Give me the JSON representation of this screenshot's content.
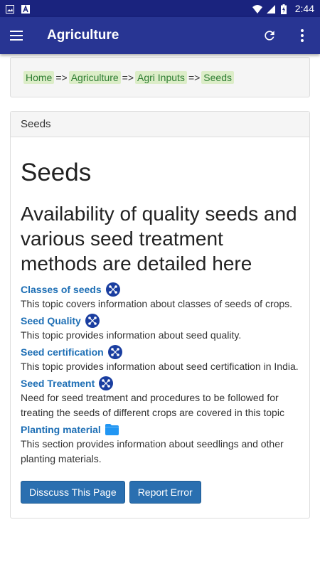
{
  "status_bar": {
    "time": "2:44",
    "icons": [
      "image-icon",
      "notification-a-icon",
      "wifi-icon",
      "signal-icon",
      "battery-charging-icon"
    ]
  },
  "app_bar": {
    "title": "Agriculture",
    "menu_icon": "hamburger-menu-icon",
    "refresh_icon": "refresh-icon",
    "more_icon": "more-vertical-icon",
    "bg_color": "#283593"
  },
  "breadcrumb": {
    "items": [
      "Home",
      "Agriculture",
      "Agri Inputs",
      "Seeds"
    ],
    "separator": "=>"
  },
  "panel": {
    "header": "Seeds",
    "heading": "Seeds",
    "subheading": "Availability of quality seeds and various seed treatment methods are detailed here"
  },
  "topics": [
    {
      "title": "Classes of seeds",
      "icon": "topic-hub-icon",
      "desc": "This topic covers information about classes of seeds of crops."
    },
    {
      "title": "Seed Quality",
      "icon": "topic-hub-icon",
      "desc": "This topic provides information about seed quality."
    },
    {
      "title": "Seed certification",
      "icon": "topic-hub-icon",
      "desc": "This topic provides information about seed certification in India."
    },
    {
      "title": "Seed Treatment",
      "icon": "topic-hub-icon",
      "desc": "Need for seed treatment and procedures to be followed for treating the seeds of different crops are covered in this topic"
    },
    {
      "title": "Planting material",
      "icon": "folder-icon",
      "desc": "This section provides information about seedlings and other planting materials."
    }
  ],
  "buttons": {
    "discuss": "Disscuss This Page",
    "report": "Report Error"
  },
  "colors": {
    "link": "#1e6fb5",
    "crumb_bg": "#dcedc8",
    "crumb_text": "#2e7d32",
    "button": "#2a6fb0"
  }
}
